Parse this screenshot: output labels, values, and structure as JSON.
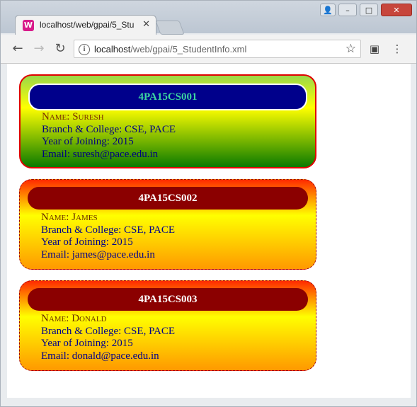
{
  "browser": {
    "tab_title": "localhost/web/gpai/5_Stu",
    "tab_icon_char": "W",
    "url_host": "localhost",
    "url_path": "/web/gpai/5_StudentInfo.xml"
  },
  "students": [
    {
      "roll": "4PA15CS001",
      "name": "Name: Suresh",
      "branch": "Branch & College: CSE, PACE",
      "year": "Year of Joining: 2015",
      "email": "Email: suresh@pace.edu.in"
    },
    {
      "roll": "4PA15CS002",
      "name": "Name: James",
      "branch": "Branch & College: CSE, PACE",
      "year": "Year of Joining: 2015",
      "email": "Email: james@pace.edu.in"
    },
    {
      "roll": "4PA15CS003",
      "name": "Name: Donald",
      "branch": "Branch & College: CSE, PACE",
      "year": "Year of Joining: 2015",
      "email": "Email: donald@pace.edu.in"
    }
  ]
}
